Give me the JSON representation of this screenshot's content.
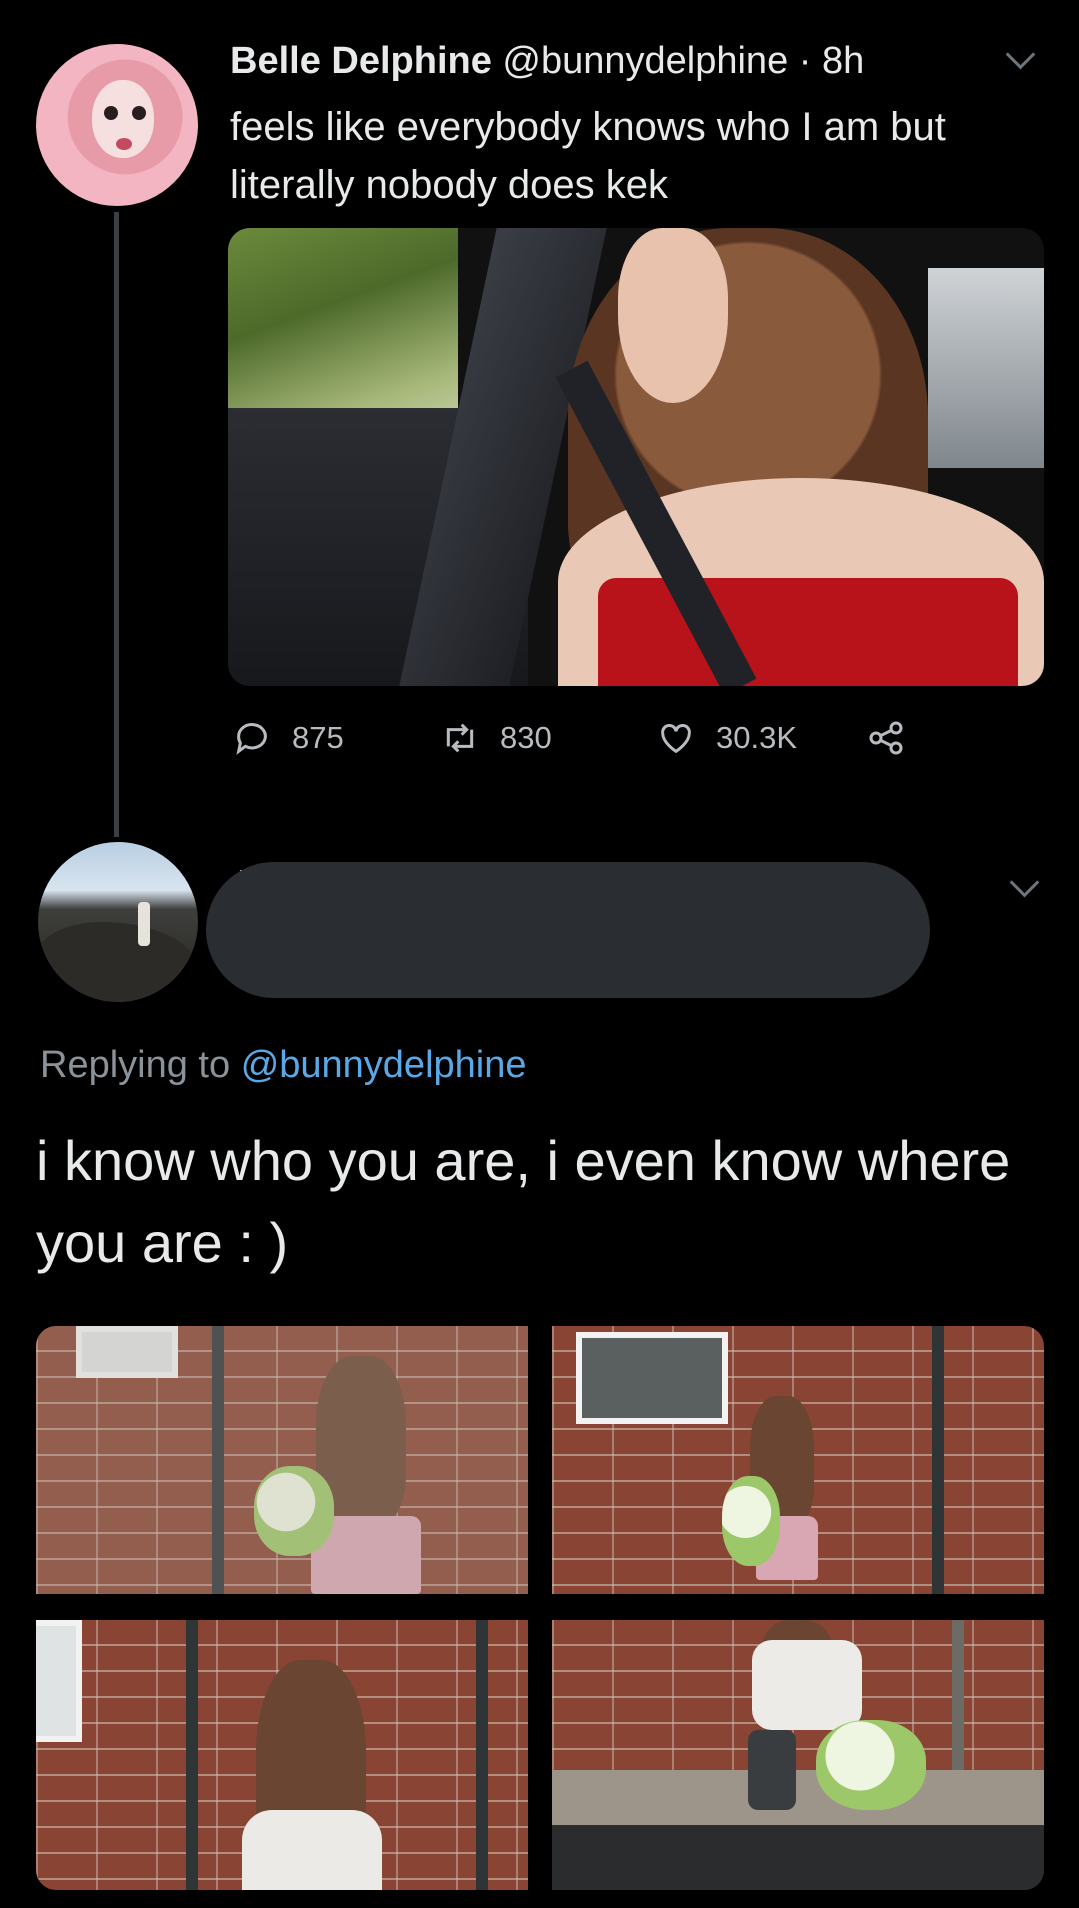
{
  "tweet": {
    "author_name": "Belle Delphine",
    "author_handle": "@bunnydelphine",
    "separator": "·",
    "time": "8h",
    "text": "feels like everybody knows who I am but literally nobody does kek",
    "stats": {
      "replies": "875",
      "retweets": "830",
      "likes": "30.3K"
    }
  },
  "reply": {
    "replying_prefix": "Replying to",
    "replying_handle": "@bunnydelphine",
    "text": "i know who you are, i even know where you are : )"
  },
  "icons": [
    "more-chevron-icon",
    "reply-icon",
    "retweet-icon",
    "like-icon",
    "share-icon"
  ],
  "colors": {
    "background": "#000000",
    "text": "#e7e9ea",
    "muted": "#8b939a",
    "link": "#5aa9e6",
    "redaction": "#2a2d31"
  }
}
